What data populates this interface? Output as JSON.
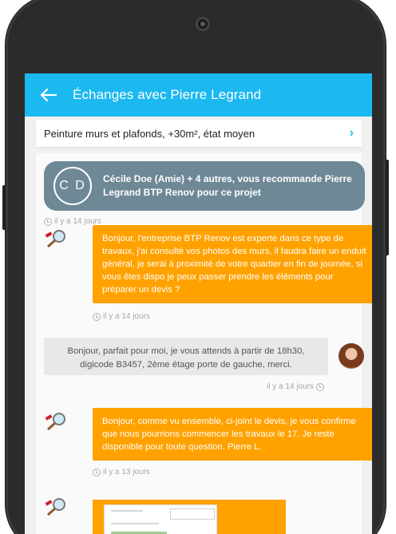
{
  "appbar": {
    "title": "Échanges avec Pierre Legrand"
  },
  "subject": {
    "text": "Peinture murs et plafonds, +30m², état moyen"
  },
  "recommendation": {
    "initials": "C D",
    "text": "Cécile Doe (Amie) + 4 autres, vous recommande Pierre Legrand BTP Renov pour ce projet",
    "time": "il y a 14 jours"
  },
  "messages": [
    {
      "from": "pro",
      "text": "Bonjour, l'entreprise BTP Renov est experte dans ce type de travaux, j'ai consulté vos photos des murs, il faudra faire un enduit général, je serai à proximité de votre quartier en fin de journée, si vous êtes dispo je peux passer prendre les éléments pour préparer un devis ?",
      "time": "il y a 14 jours"
    },
    {
      "from": "user",
      "text": "Bonjour, parfait pour moi, je vous attends à partir de 18h30, digicode B3457, 2ème étage porte de gauche, merci.",
      "time": "il y a 14 jours"
    },
    {
      "from": "pro",
      "text": "Bonjour, comme vu ensemble, ci-joint le devis, je vous confirme que nous pourrions commencer les travaux le 17. Je reste disponible pour toute question. Pierre L.",
      "time": "il y a 13 jours"
    }
  ],
  "colors": {
    "appbar": "#1cb8f0",
    "bubble_out": "#ffa200",
    "recommendation": "#6e8896"
  }
}
